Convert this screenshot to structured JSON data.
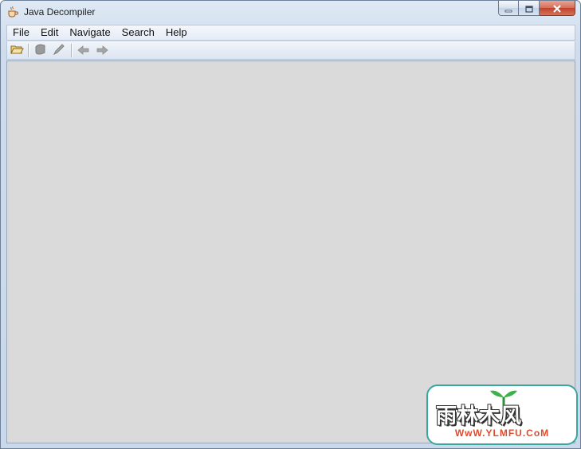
{
  "window": {
    "title": "Java Decompiler",
    "app_icon": "coffee-cup-icon"
  },
  "caption_buttons": {
    "minimize": "minimize-icon",
    "maximize": "maximize-icon",
    "close": "close-icon"
  },
  "menu": {
    "items": [
      {
        "label": "File"
      },
      {
        "label": "Edit"
      },
      {
        "label": "Navigate"
      },
      {
        "label": "Search"
      },
      {
        "label": "Help"
      }
    ]
  },
  "toolbar": {
    "buttons": [
      {
        "icon": "open-folder-icon",
        "enabled": true
      },
      {
        "icon": "save-all-icon",
        "enabled": false
      },
      {
        "icon": "edit-pencil-icon",
        "enabled": false
      },
      {
        "icon": "back-arrow-icon",
        "enabled": false
      },
      {
        "icon": "forward-arrow-icon",
        "enabled": false
      }
    ]
  },
  "watermark": {
    "brand_text": "雨林木风",
    "url": "WwW.YLMFU.CoM",
    "accent_color": "#3aa6a0",
    "url_color": "#e04a2c"
  },
  "colors": {
    "content_background": "#dadada",
    "frame": "#c9d8ea"
  }
}
